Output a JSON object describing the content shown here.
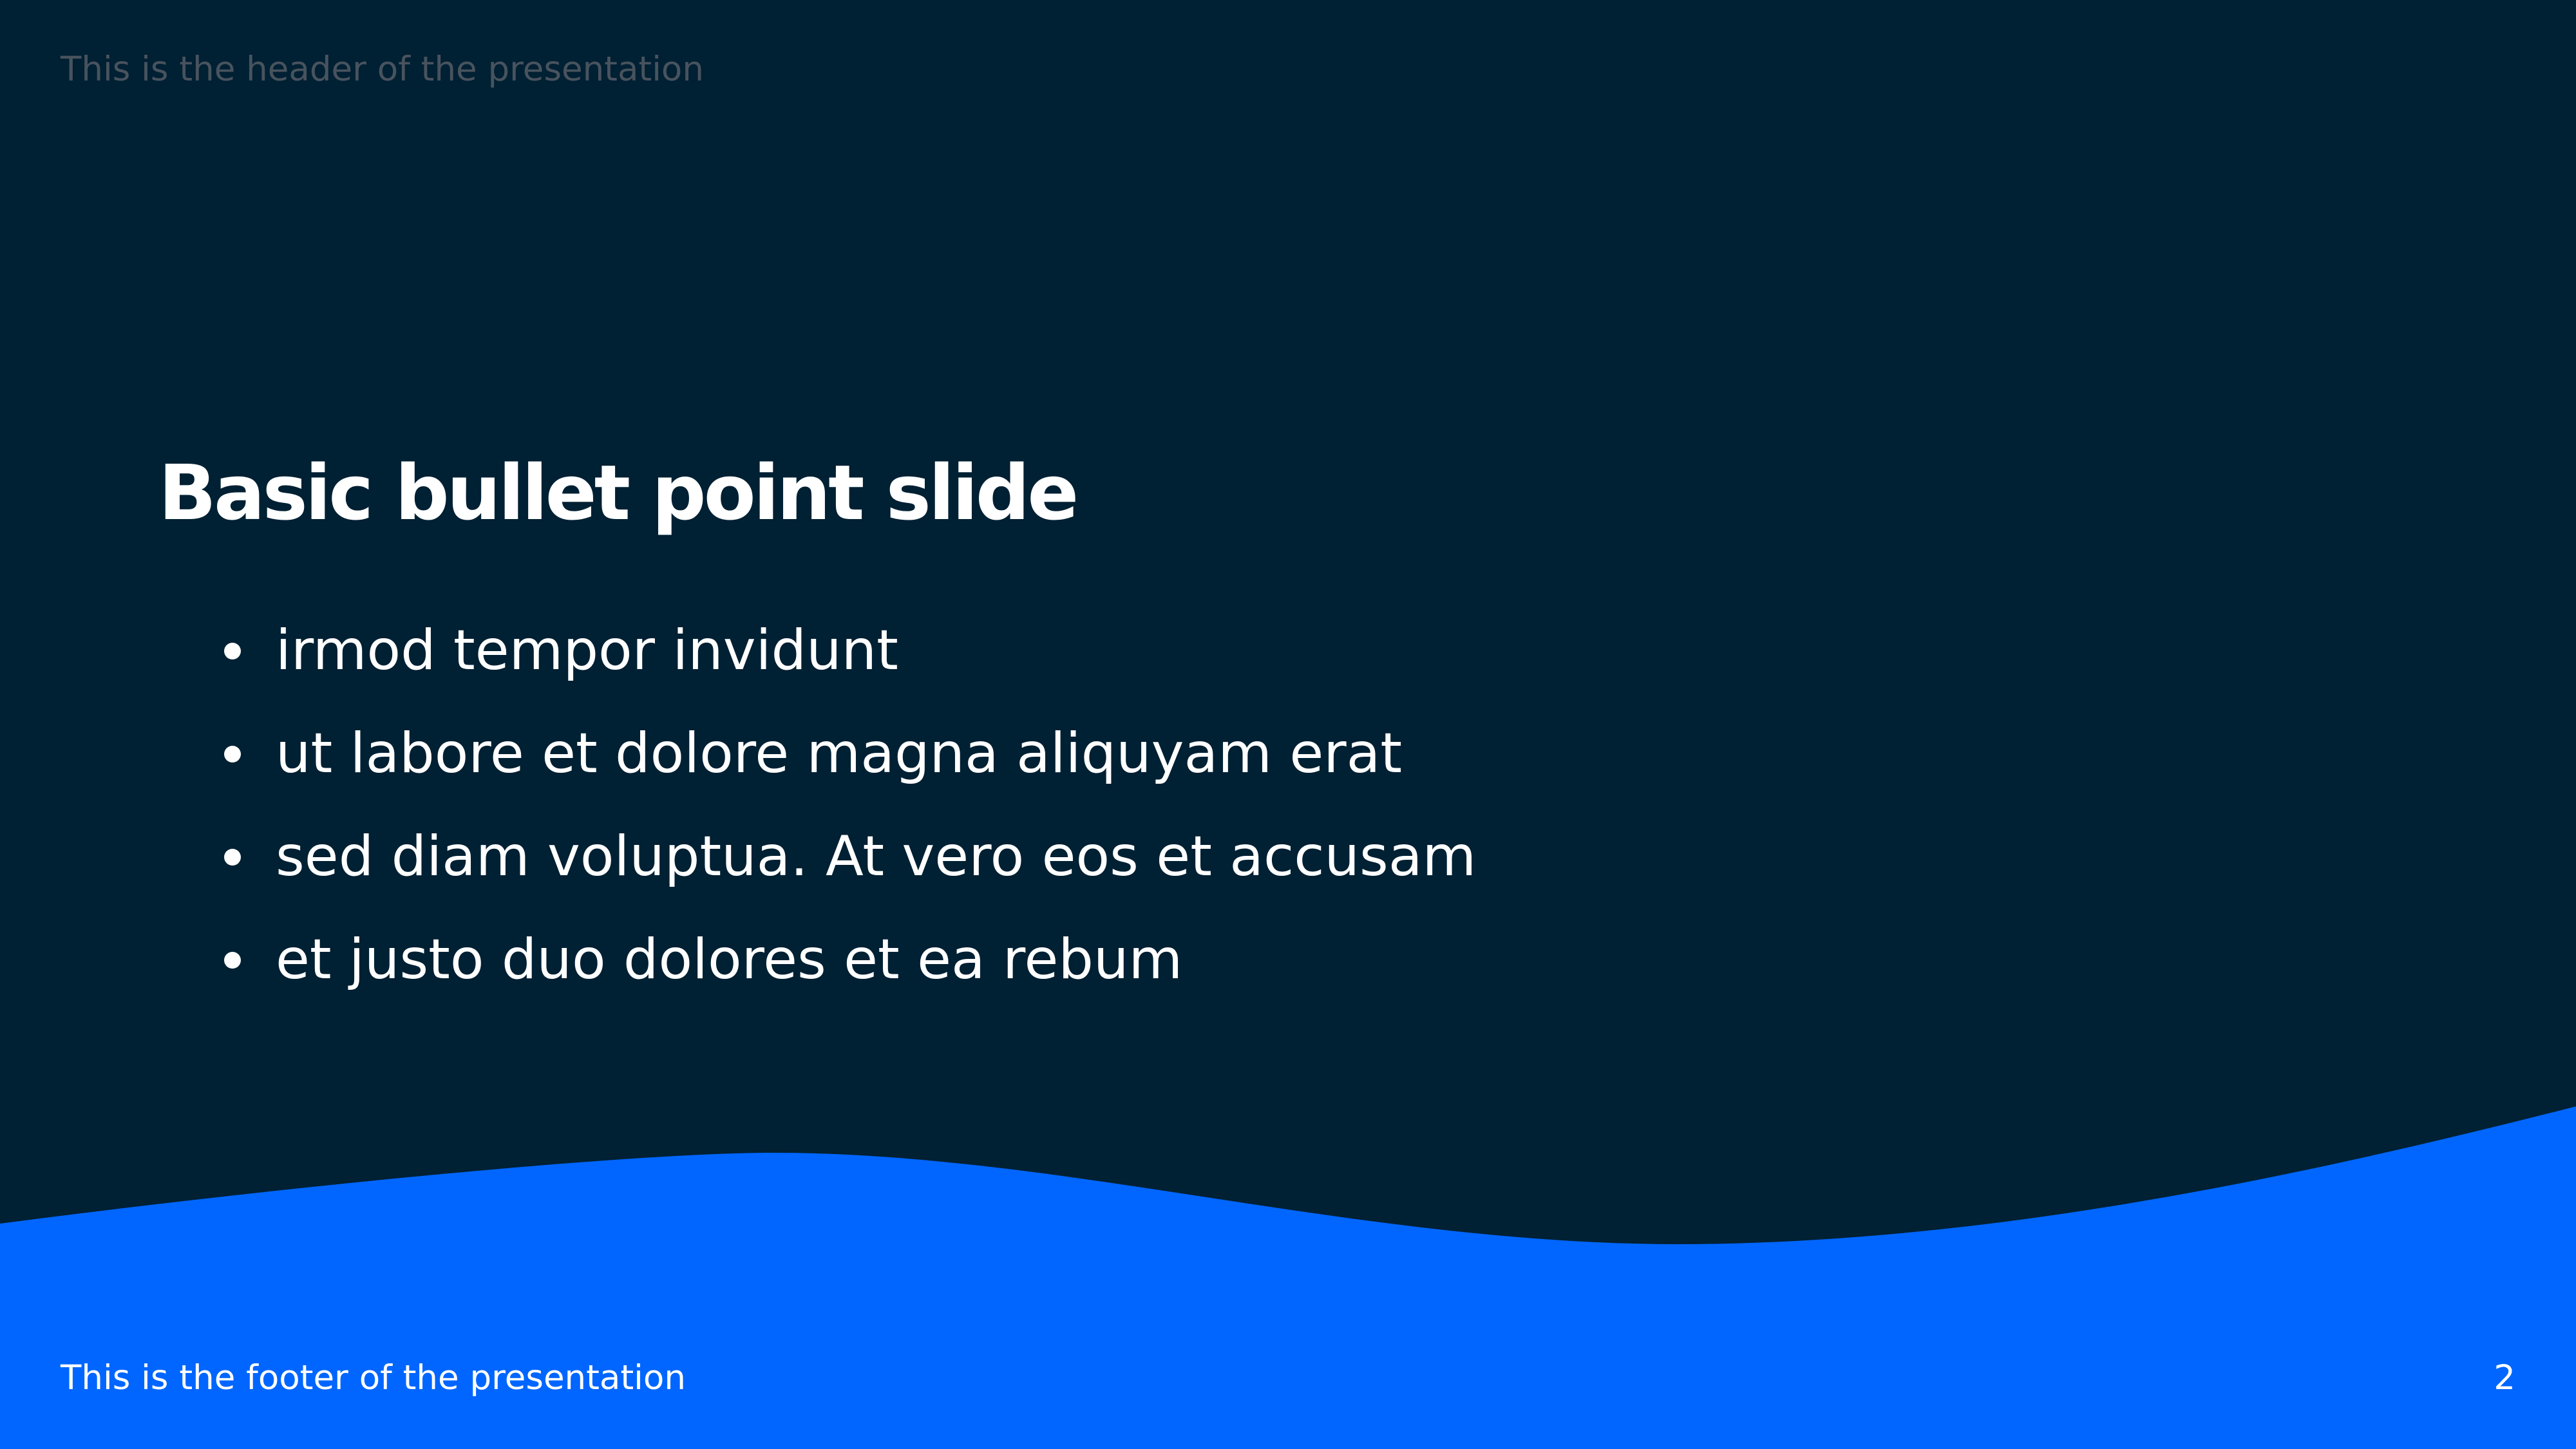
{
  "slide": {
    "header": "This is the header of the presentation",
    "title": "Basic bullet point slide",
    "bullets": [
      "irmod tempor invidunt",
      "ut labore et dolore magna aliquyam erat",
      "sed diam voluptua. At vero eos et accusam",
      "et justo duo dolores et ea rebum"
    ],
    "footer": "This is the footer of the presentation",
    "page_number": "2"
  },
  "colors": {
    "background": "#002033",
    "wave": "#0066ff",
    "header_text": "#48535e",
    "text": "#ffffff"
  }
}
